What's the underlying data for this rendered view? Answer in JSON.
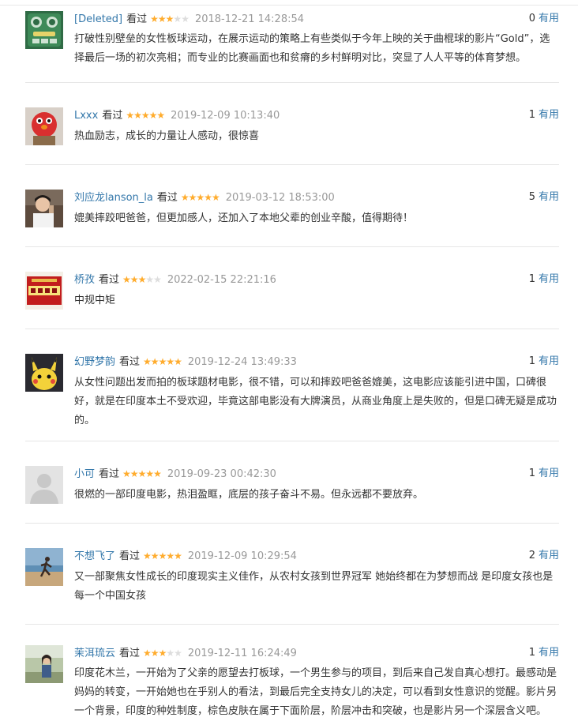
{
  "useful_label": "有用",
  "watched_label": "看过",
  "comments": [
    {
      "user": "[Deleted]",
      "avatar": "avatar-green-device",
      "rating": 3,
      "time": "2018-12-21 14:28:54",
      "votes": "0",
      "content": "打破性别壁垒的女性板球运动，在展示运动的策略上有些类似于今年上映的关于曲棍球的影片“Gold”，选择最后一场的初次亮相；而专业的比赛画面也和贫瘠的乡村鲜明对比，突显了人人平等的体育梦想。"
    },
    {
      "user": "Lxxx",
      "avatar": "avatar-red-elmo",
      "rating": 5,
      "time": "2019-12-09 10:13:40",
      "votes": "1",
      "content": "热血励志，成长的力量让人感动，很惊喜"
    },
    {
      "user": "刘应龙lanson_la",
      "avatar": "avatar-person-photo",
      "rating": 5,
      "time": "2019-03-12 18:53:00",
      "votes": "5",
      "content": "媲美摔跤吧爸爸，但更加感人，还加入了本地父辈的创业辛酸，值得期待！"
    },
    {
      "user": "桥孜",
      "avatar": "avatar-red-label",
      "rating": 3,
      "time": "2022-02-15 22:21:16",
      "votes": "1",
      "content": "中规中矩"
    },
    {
      "user": "幻野梦韵",
      "avatar": "avatar-pikachu",
      "rating": 5,
      "time": "2019-12-24 13:49:33",
      "votes": "1",
      "content": "从女性问题出发而拍的板球题材电影，很不错，可以和摔跤吧爸爸媲美，这电影应该能引进中国，口碑很好，就是在印度本土不受欢迎，毕竟这部电影没有大牌演员，从商业角度上是失败的，但是口碑无疑是成功的。"
    },
    {
      "user": "小可",
      "avatar": "avatar-default-gray",
      "rating": 5,
      "time": "2019-09-23 00:42:30",
      "votes": "1",
      "content": "很燃的一部印度电影，热泪盈眶，底层的孩子奋斗不易。但永远都不要放弃。"
    },
    {
      "user": "不想飞了",
      "avatar": "avatar-beach-runner",
      "rating": 5,
      "time": "2019-12-09 10:29:54",
      "votes": "2",
      "content": "又一部聚焦女性成长的印度现实主义佳作，从农村女孩到世界冠军 她始终都在为梦想而战 是印度女孩也是每一个中国女孩"
    },
    {
      "user": "茉洱琉云",
      "avatar": "avatar-girl-outdoor",
      "rating": 3,
      "time": "2019-12-11 16:24:49",
      "votes": "1",
      "content": "印度花木兰，一开始为了父亲的愿望去打板球，一个男生参与的项目，到后来自己发自真心想打。最感动是妈妈的转变，一开始她也在乎别人的看法，到最后完全支持女儿的决定，可以看到女性意识的觉醒。影片另一个背景，印度的种姓制度，棕色皮肤在属于下面阶层，阶层冲击和突破，也是影片另一个深层含义吧。"
    }
  ]
}
